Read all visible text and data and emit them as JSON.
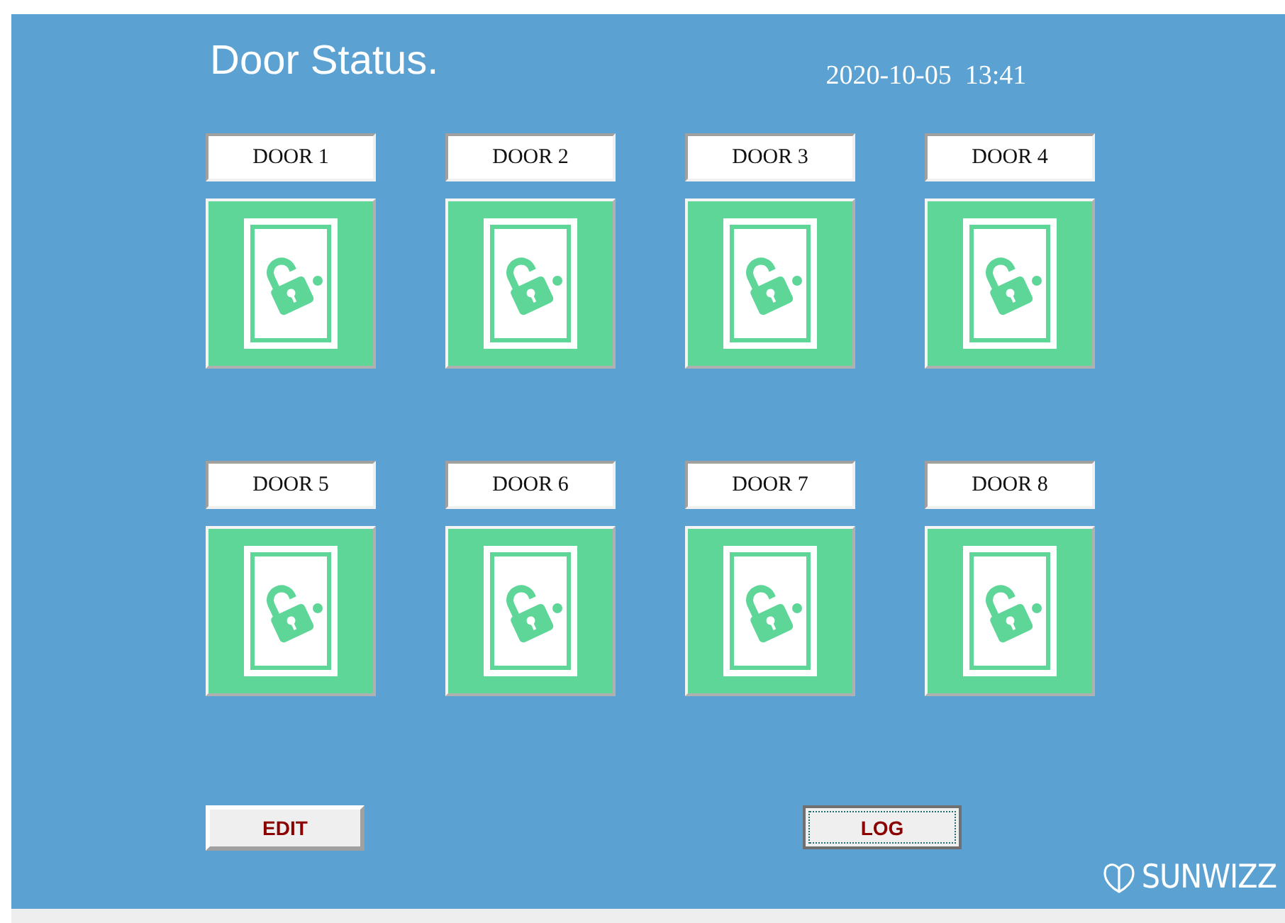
{
  "title": "Door Status.",
  "datetime": "2020-10-05  13:41",
  "doors": [
    {
      "label": "DOOR 1",
      "locked": false
    },
    {
      "label": "DOOR 2",
      "locked": false
    },
    {
      "label": "DOOR 3",
      "locked": false
    },
    {
      "label": "DOOR 4",
      "locked": false
    },
    {
      "label": "DOOR 5",
      "locked": false
    },
    {
      "label": "DOOR 6",
      "locked": false
    },
    {
      "label": "DOOR 7",
      "locked": false
    },
    {
      "label": "DOOR 8",
      "locked": false
    }
  ],
  "buttons": [
    {
      "label": "EDIT",
      "focused": false
    },
    {
      "label": "LOG",
      "focused": true
    }
  ],
  "logo": "SUNWIZZ"
}
